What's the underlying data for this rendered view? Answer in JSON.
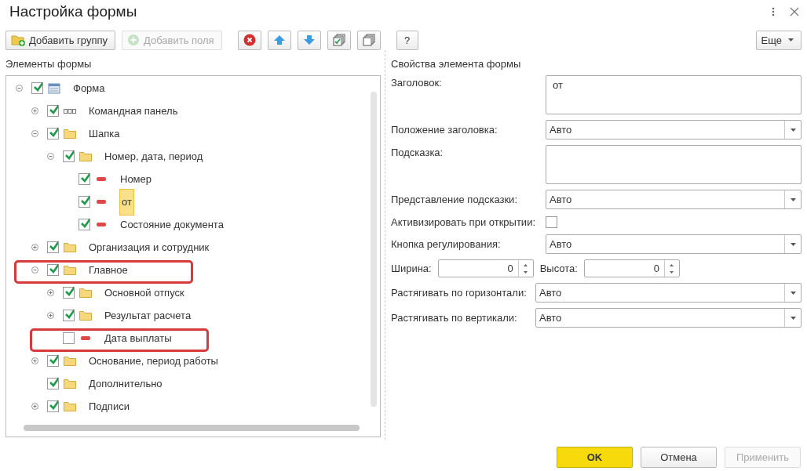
{
  "window": {
    "title": "Настройка формы"
  },
  "toolbar": {
    "buttons": [
      {
        "kind": "add-group",
        "label": "Добавить группу",
        "disabled": false
      },
      {
        "kind": "add-fields",
        "label": "Добавить поля",
        "disabled": true
      },
      {
        "kind": "delete",
        "disabled": false
      },
      {
        "kind": "move-up",
        "disabled": false
      },
      {
        "kind": "move-down",
        "disabled": false
      },
      {
        "kind": "check-all",
        "disabled": false
      },
      {
        "kind": "uncheck-all",
        "disabled": false
      },
      {
        "kind": "help",
        "label": "?",
        "disabled": false
      }
    ],
    "more": {
      "label": "Еще"
    }
  },
  "elements": {
    "title": "Элементы формы",
    "tree": [
      {
        "label": "Форма",
        "kind": "form",
        "expanded": true,
        "checked": true,
        "selected": false,
        "annotated": false,
        "children": [
          {
            "label": "Командная панель",
            "kind": "panel",
            "expanded": false,
            "checked": true,
            "selected": false,
            "annotated": false
          },
          {
            "label": "Шапка",
            "kind": "group",
            "expanded": true,
            "checked": true,
            "selected": false,
            "annotated": false,
            "children": [
              {
                "label": "Номер, дата, период",
                "kind": "group",
                "expanded": true,
                "checked": true,
                "selected": false,
                "annotated": false,
                "children": [
                  {
                    "label": "Номер",
                    "kind": "field",
                    "checked": true,
                    "selected": false,
                    "annotated": false
                  },
                  {
                    "label": "от",
                    "kind": "field",
                    "checked": true,
                    "selected": true,
                    "annotated": false
                  },
                  {
                    "label": "Состояние документа",
                    "kind": "field",
                    "checked": true,
                    "selected": false,
                    "annotated": false
                  }
                ]
              }
            ]
          },
          {
            "label": "Организация и сотрудник",
            "kind": "group",
            "expanded": false,
            "checked": true,
            "selected": false,
            "annotated": false
          },
          {
            "label": "Главное",
            "kind": "group",
            "expanded": true,
            "checked": true,
            "selected": false,
            "annotated": true,
            "children": [
              {
                "label": "Основной отпуск",
                "kind": "group",
                "expanded": false,
                "checked": true,
                "selected": false,
                "annotated": false
              },
              {
                "label": "Результат расчета",
                "kind": "group",
                "expanded": false,
                "checked": true,
                "selected": false,
                "annotated": false
              },
              {
                "label": "Дата выплаты",
                "kind": "field",
                "checked": false,
                "selected": false,
                "annotated": true
              }
            ]
          },
          {
            "label": "Основание, период работы",
            "kind": "group",
            "expanded": false,
            "checked": true,
            "selected": false,
            "annotated": false
          },
          {
            "label": "Дополнительно",
            "kind": "group",
            "checked": true,
            "selected": false,
            "annotated": false
          },
          {
            "label": "Подписи",
            "kind": "group",
            "expanded": false,
            "checked": true,
            "selected": false,
            "annotated": false
          }
        ]
      }
    ]
  },
  "properties": {
    "title": "Свойства элемента формы",
    "fields": [
      {
        "kind": "textarea",
        "label": "Заголовок:",
        "value": "от"
      },
      {
        "kind": "select",
        "label": "Положение заголовка:",
        "value": "Авто"
      },
      {
        "kind": "textarea",
        "label": "Подсказка:"
      },
      {
        "kind": "select",
        "label": "Представление подсказки:",
        "value": "Авто"
      },
      {
        "kind": "checkbox",
        "label": "Активизировать при открытии:",
        "checked": false
      },
      {
        "kind": "select",
        "label": "Кнопка регулирования:",
        "value": "Авто"
      },
      {
        "kind": "size",
        "parts": [
          {
            "label": "Ширина:",
            "value": "0"
          },
          {
            "label": "Высота:",
            "value": "0"
          }
        ]
      },
      {
        "kind": "select-wide",
        "label": "Растягивать по горизонтали:",
        "value": "Авто"
      },
      {
        "kind": "select-wide",
        "label": "Растягивать по вертикали:",
        "value": "Авто"
      }
    ]
  },
  "footer": {
    "buttons": [
      {
        "kind": "primary",
        "label": "OK",
        "disabled": false
      },
      {
        "kind": "default",
        "label": "Отмена",
        "disabled": false
      },
      {
        "kind": "default",
        "label": "Применить",
        "disabled": true
      }
    ]
  }
}
